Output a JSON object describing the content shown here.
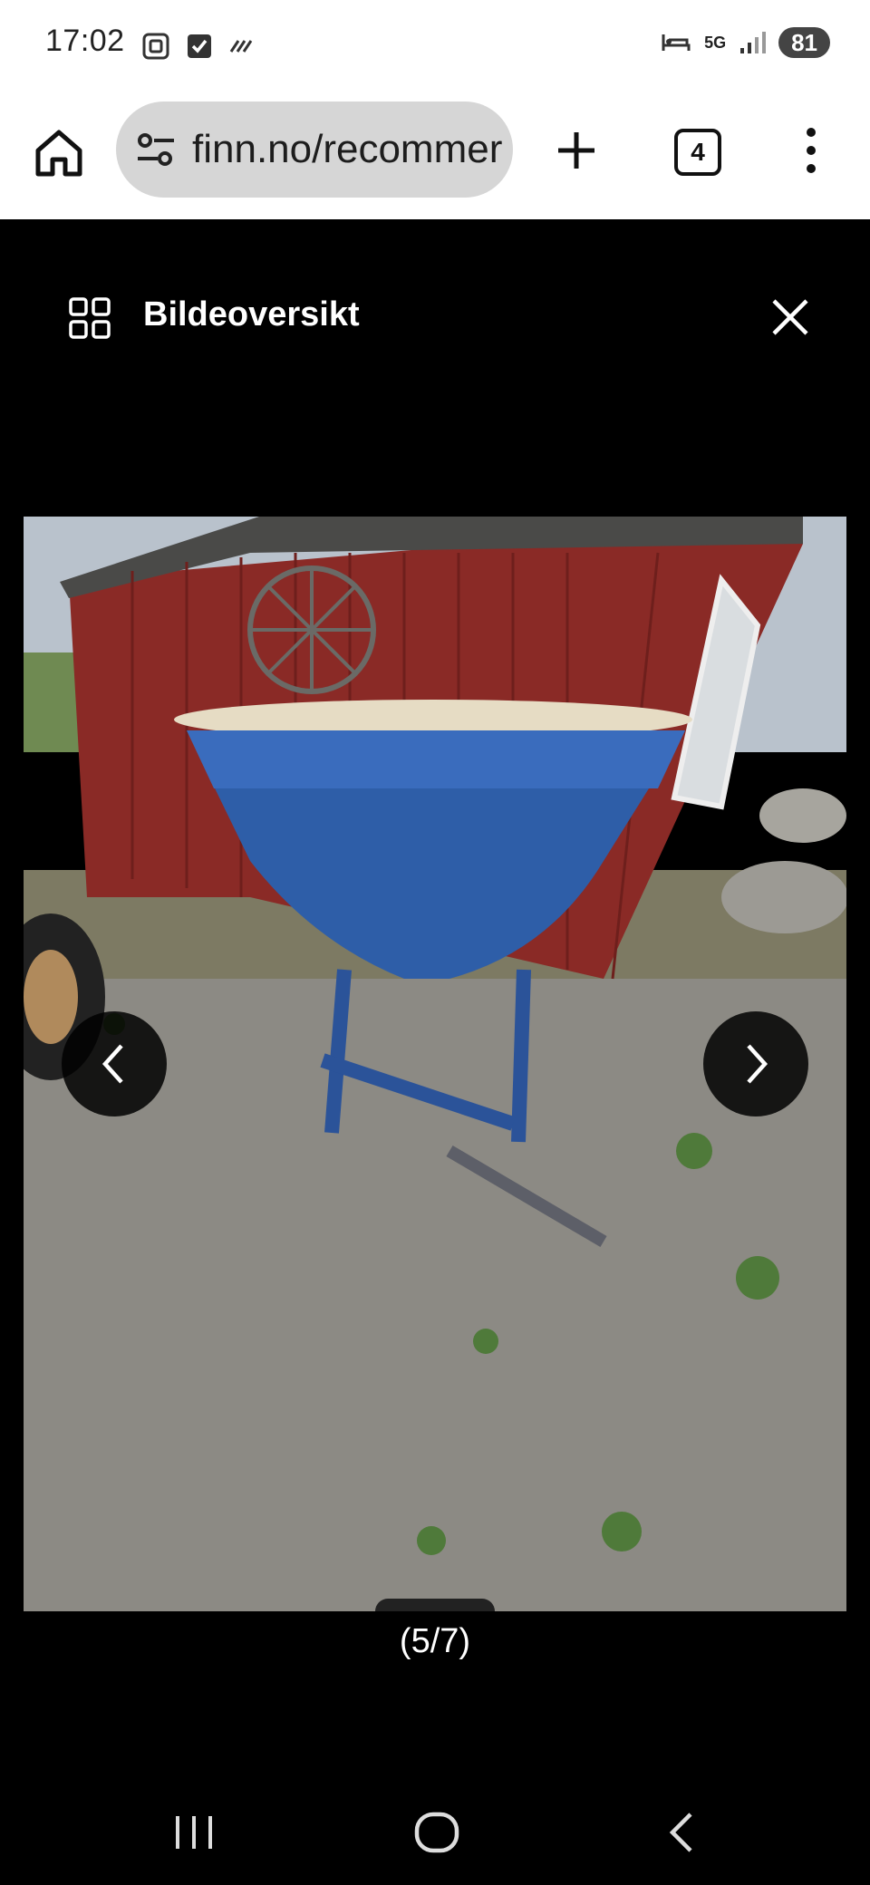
{
  "status_bar": {
    "time": "17:02",
    "network": "5G",
    "battery": "81"
  },
  "browser": {
    "url": "finn.no/recommer",
    "tab_count": "4"
  },
  "viewer": {
    "title": "Bildeoversikt",
    "counter": "(5/7)"
  },
  "icons": {
    "home": "home-icon",
    "site_settings": "tune-icon",
    "new_tab": "plus-icon",
    "tabs": "tab-switcher-icon",
    "menu": "more-vert-icon",
    "grid": "grid-icon",
    "close": "close-icon",
    "prev": "chevron-left-icon",
    "next": "chevron-right-icon"
  },
  "colors": {
    "viewer_bg": "#000000",
    "browser_bg": "#ffffff",
    "url_pill": "#d6d6d6"
  }
}
